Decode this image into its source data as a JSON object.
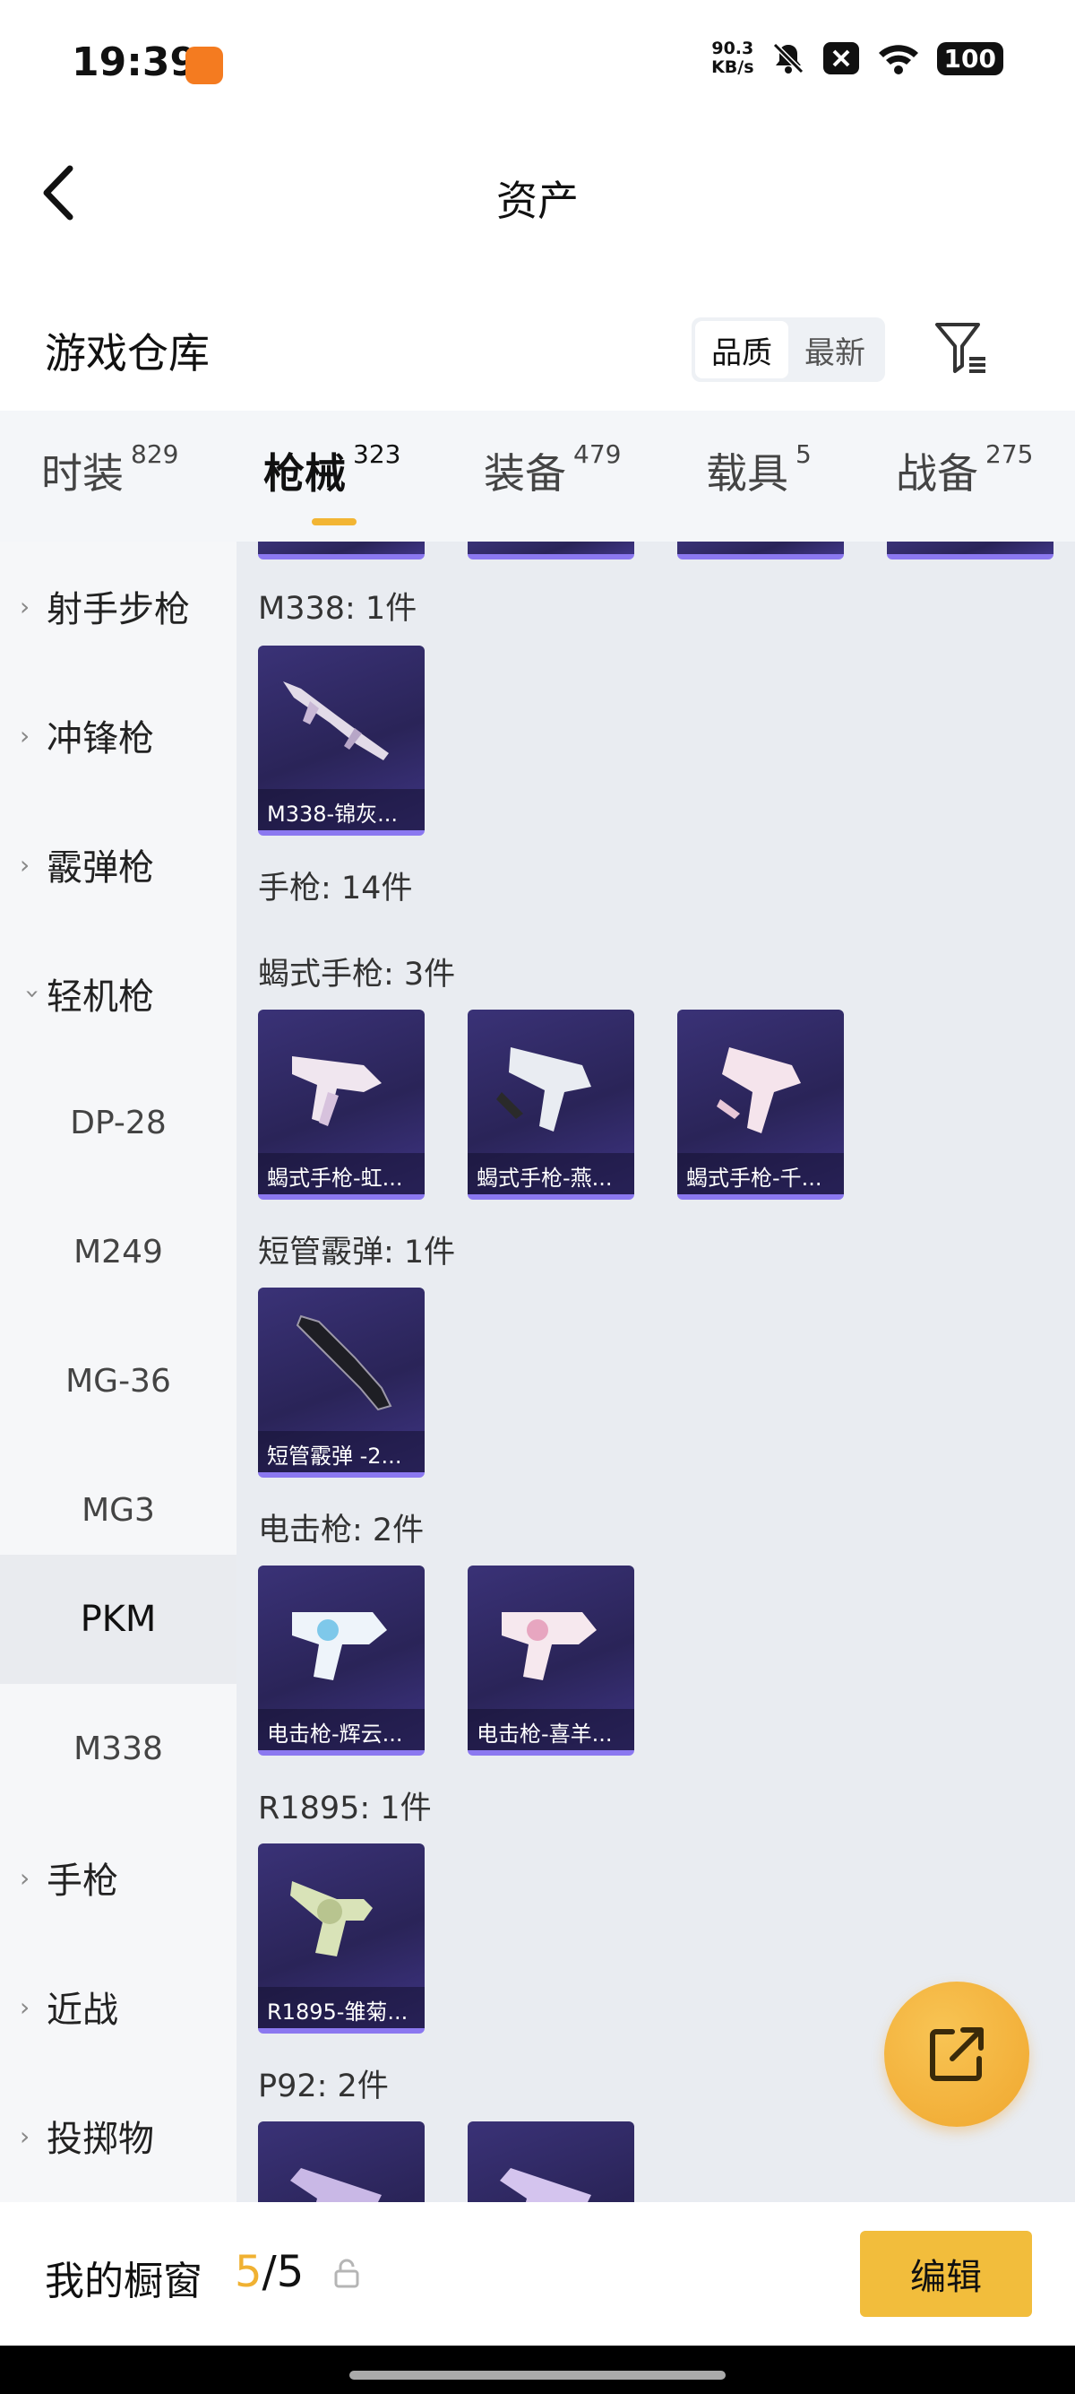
{
  "status": {
    "time": "19:39",
    "speed_top": "90.3",
    "speed_bottom": "KB/s",
    "battery": "100"
  },
  "header": {
    "title": "资产"
  },
  "section": {
    "title": "游戏仓库",
    "sort_options": [
      "品质",
      "最新"
    ],
    "sort_active": "品质"
  },
  "tabs": [
    {
      "label": "时装",
      "count": "829"
    },
    {
      "label": "枪械",
      "count": "323"
    },
    {
      "label": "装备",
      "count": "479"
    },
    {
      "label": "载具",
      "count": "5"
    },
    {
      "label": "战备",
      "count": "275"
    }
  ],
  "active_tab": "枪械",
  "sidebar": {
    "items": [
      {
        "label": "射手步枪",
        "type": "category"
      },
      {
        "label": "冲锋枪",
        "type": "category"
      },
      {
        "label": "霰弹枪",
        "type": "category"
      },
      {
        "label": "轻机枪",
        "type": "category-open"
      },
      {
        "label": "DP-28",
        "type": "sub"
      },
      {
        "label": "M249",
        "type": "sub"
      },
      {
        "label": "MG-36",
        "type": "sub"
      },
      {
        "label": "MG3",
        "type": "sub"
      },
      {
        "label": "PKM",
        "type": "sub-active"
      },
      {
        "label": "M338",
        "type": "sub"
      },
      {
        "label": "手枪",
        "type": "category"
      },
      {
        "label": "近战",
        "type": "category"
      },
      {
        "label": "投掷物",
        "type": "category"
      }
    ]
  },
  "groups": [
    {
      "title": "M338: 1件",
      "items": [
        "M338-锦灰..."
      ]
    },
    {
      "title": "手枪: 14件",
      "items": []
    },
    {
      "title": "蝎式手枪: 3件",
      "items": [
        "蝎式手枪-虹...",
        "蝎式手枪-燕...",
        "蝎式手枪-千..."
      ]
    },
    {
      "title": "短管霰弹: 1件",
      "items": [
        "短管霰弹 -2..."
      ]
    },
    {
      "title": "电击枪: 2件",
      "items": [
        "电击枪-辉云...",
        "电击枪-喜羊..."
      ]
    },
    {
      "title": "R1895: 1件",
      "items": [
        "R1895-雏菊..."
      ]
    },
    {
      "title": "P92: 2件",
      "items": [
        "",
        ""
      ]
    }
  ],
  "bottom": {
    "label": "我的橱窗",
    "current": "5",
    "total": "/5",
    "edit_label": "编辑"
  },
  "colors": {
    "accent": "#f2bd3c",
    "card": "#2f2863",
    "card_edge": "#8b78f0"
  }
}
